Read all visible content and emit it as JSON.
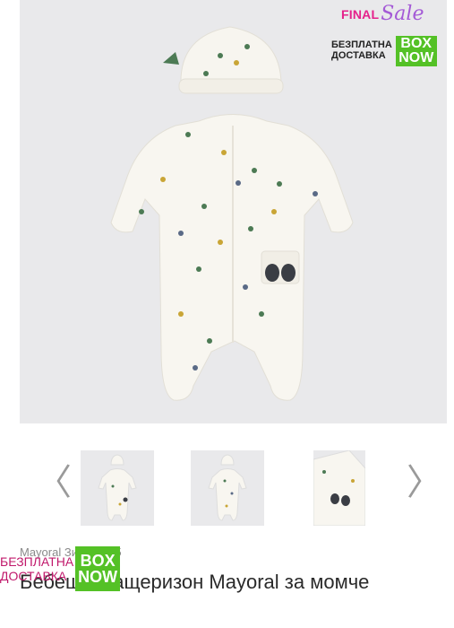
{
  "promo": {
    "final_label": "FINAL",
    "sale_label": "Sale"
  },
  "delivery_badge": {
    "line1": "БЕЗПЛАТНА",
    "line2": "ДОСТАВКА",
    "logo_line1": "BOX",
    "logo_line2": "NOW"
  },
  "carousel": {
    "prev_icon": "chevron-left-icon",
    "next_icon": "chevron-right-icon",
    "prev_glyph": "〈",
    "next_glyph": "〉"
  },
  "product": {
    "meta": "Mayoral Зима 2025",
    "title": "Бебешки гащеризон Mayoral за момче"
  },
  "colors": {
    "hero_bg": "#e9e9eb",
    "box_now_green": "#54c126",
    "final_pink": "#e5218b",
    "delivery_text_pink": "#c0186b"
  }
}
